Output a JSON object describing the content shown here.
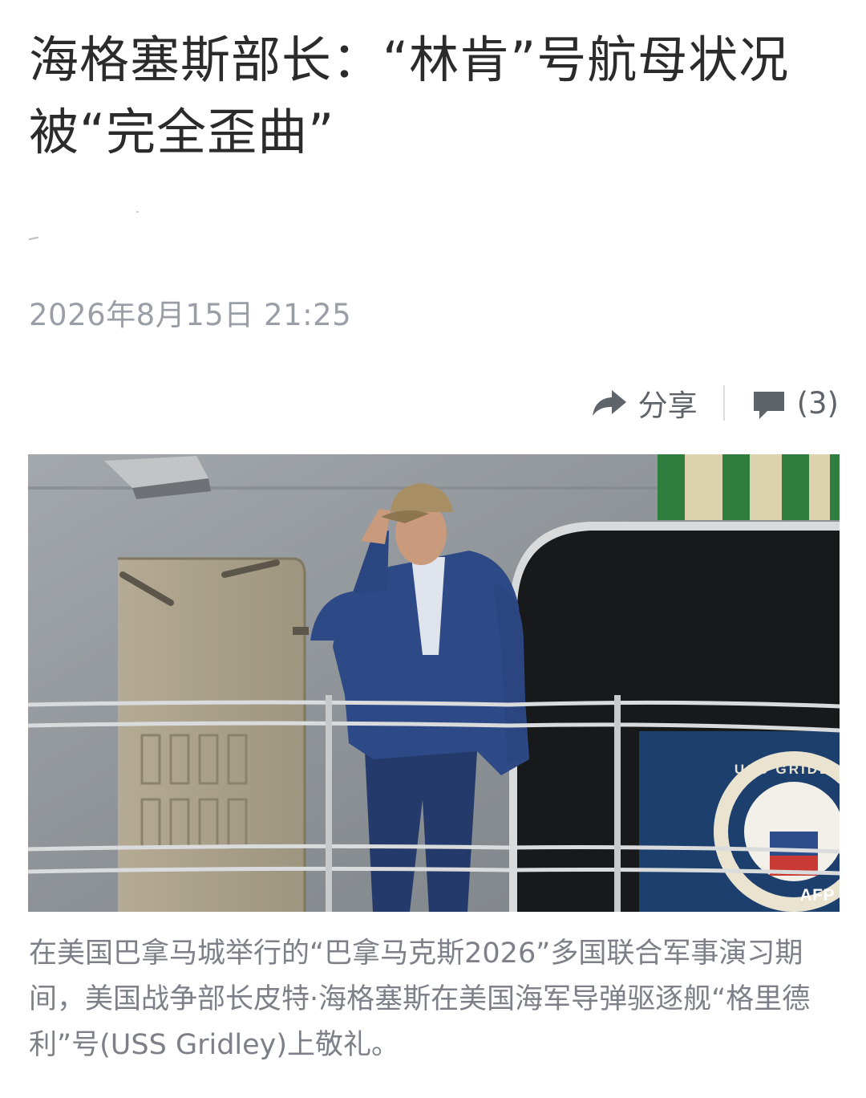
{
  "article": {
    "title": "海格塞斯部长：“林肯”号航母状况被“完全歪曲”",
    "date": "2026年8月15日 21:25"
  },
  "toolbar": {
    "share_label": "分享",
    "comment_count": "(3)"
  },
  "photo": {
    "credit": "AFP",
    "flag_text": "USS GRIDLEY",
    "caption": "在美国巴拿马城举行的“巴拿马克斯2026”多国联合军事演习期间，美国战争部长皮特·海格塞斯在美国海军导弹驱逐舰“格里德利”号(USS Gridley)上敬礼。"
  },
  "colors": {
    "title": "#2b2b2b",
    "meta": "#9a9ea6",
    "caption": "#7d8088",
    "icon": "#5f636a"
  },
  "icons": {
    "share": "share-arrow-icon",
    "comment": "comment-bubble-icon"
  }
}
